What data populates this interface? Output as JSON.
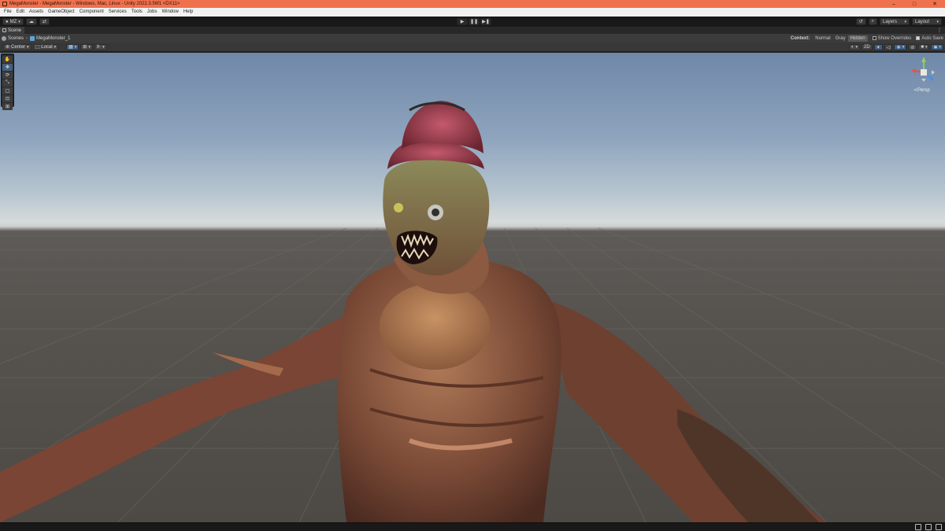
{
  "window": {
    "title": "MegaMonster - MegaMonster - Windows, Mac, Linux - Unity 2022.3.56f1 <DX11>",
    "controls": [
      "–",
      "□",
      "✕"
    ]
  },
  "menu": [
    "File",
    "Edit",
    "Assets",
    "GameObject",
    "Component",
    "Services",
    "Tools",
    "Jobs",
    "Window",
    "Help"
  ],
  "toolbar": {
    "account": "MZ",
    "play_icons": [
      "▶",
      "❚❚",
      "▶❚"
    ],
    "layers_label": "Layers",
    "layout_label": "Layout"
  },
  "scene_tab": {
    "label": "Scene"
  },
  "breadcrumb": {
    "root": "Scenes",
    "current": "MegaMonster_1"
  },
  "context": {
    "label": "Context:",
    "options": [
      "Normal",
      "Gray",
      "Hidden"
    ],
    "selected": "Hidden",
    "show_overrides": "Show Overrides",
    "auto_save": "Auto Save"
  },
  "scene_toolbar": {
    "pivot": "Center",
    "space": "Local",
    "mode_2d": "2D"
  },
  "gizmo": {
    "label": "≺Persp"
  },
  "colors": {
    "titlebar": "#f0714e",
    "accent_blue": "#5fa5d9",
    "gizmo_y": "#8fd14f",
    "gizmo_x": "#e8514a",
    "gizmo_z": "#4a8ee8"
  }
}
